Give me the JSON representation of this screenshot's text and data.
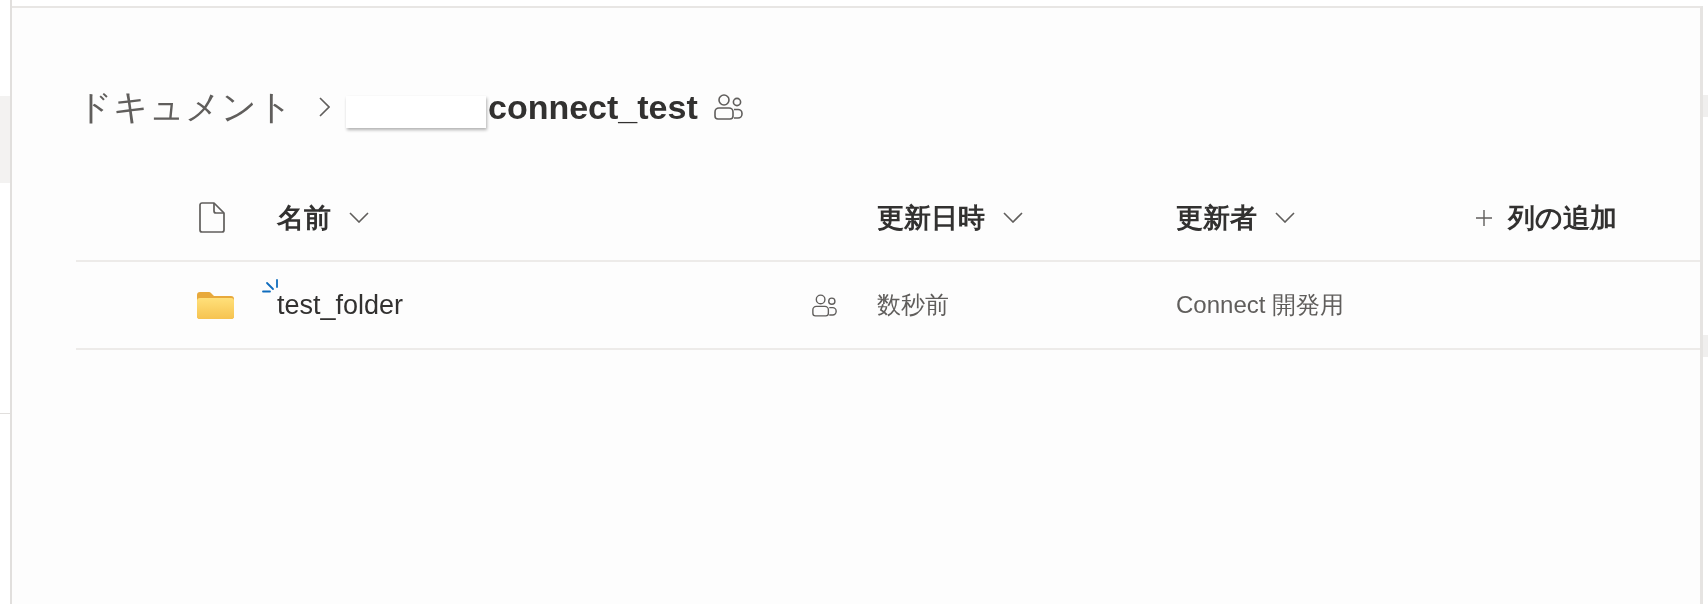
{
  "breadcrumb": {
    "items": [
      {
        "label": "ドキュメント",
        "current": false
      },
      {
        "label": "connect_test",
        "current": true,
        "redacted": true,
        "shared": true
      }
    ]
  },
  "table": {
    "columns": [
      {
        "kind": "type"
      },
      {
        "kind": "sort",
        "label": "名前"
      },
      {
        "kind": "sort",
        "label": "更新日時"
      },
      {
        "kind": "sort",
        "label": "更新者"
      },
      {
        "kind": "add",
        "label": "列の追加"
      }
    ],
    "rows": [
      {
        "kind": "folder",
        "name": "test_folder",
        "new": true,
        "shared": true,
        "modified": "数秒前",
        "modified_by": "Connect 開発用"
      }
    ]
  }
}
